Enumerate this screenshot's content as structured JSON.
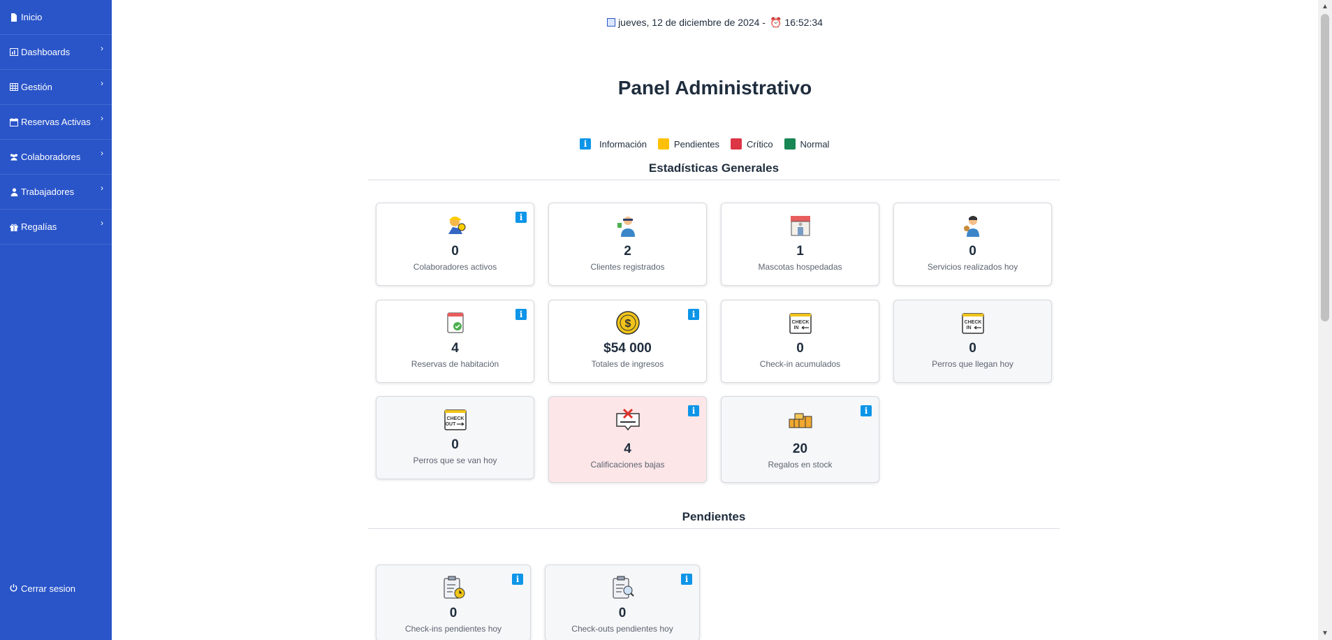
{
  "sidebar": {
    "items": [
      {
        "label": "Inicio"
      },
      {
        "label": "Dashboards"
      },
      {
        "label": "Gestión"
      },
      {
        "label": "Reservas Activas"
      },
      {
        "label": "Colaboradores"
      },
      {
        "label": "Trabajadores"
      },
      {
        "label": "Regalías"
      }
    ],
    "logout": "Cerrar sesion"
  },
  "header": {
    "date": "jueves, 12 de diciembre de 2024 -",
    "time": "16:52:34",
    "title": "Panel Administrativo"
  },
  "legend": {
    "info": "Información",
    "pending": "Pendientes",
    "critical": "Crítico",
    "normal": "Normal",
    "colors": {
      "info": "#0d95e8",
      "pending": "#ffc107",
      "critical": "#dc3545",
      "normal": "#198754"
    }
  },
  "sections": {
    "general": "Estadísticas Generales",
    "pending": "Pendientes"
  },
  "stats": [
    {
      "value": "0",
      "label": "Colaboradores activos",
      "icon": "worker-icon"
    },
    {
      "value": "2",
      "label": "Clientes registrados",
      "icon": "client-icon"
    },
    {
      "value": "1",
      "label": "Mascotas hospedadas",
      "icon": "store-icon"
    },
    {
      "value": "0",
      "label": "Servicios realizados hoy",
      "icon": "groomer-icon"
    },
    {
      "value": "4",
      "label": "Reservas de habitación",
      "icon": "calendar-check-icon"
    },
    {
      "value": "$54 000",
      "label": "Totales de ingresos",
      "icon": "coin-icon"
    },
    {
      "value": "0",
      "label": "Check-in acumulados",
      "icon": "checkin-calendar-icon"
    },
    {
      "value": "0",
      "label": "Perros que llegan hoy",
      "icon": "checkin-calendar-icon"
    },
    {
      "value": "0",
      "label": "Perros que se van hoy",
      "icon": "checkout-calendar-icon"
    },
    {
      "value": "4",
      "label": "Calificaciones bajas",
      "icon": "bad-rating-icon"
    },
    {
      "value": "20",
      "label": "Regalos en stock",
      "icon": "gift-boxes-icon"
    }
  ],
  "pending": [
    {
      "value": "0",
      "label": "Check-ins pendientes hoy",
      "icon": "clipboard-clock-icon"
    },
    {
      "value": "0",
      "label": "Check-outs pendientes hoy",
      "icon": "clipboard-search-icon"
    }
  ]
}
